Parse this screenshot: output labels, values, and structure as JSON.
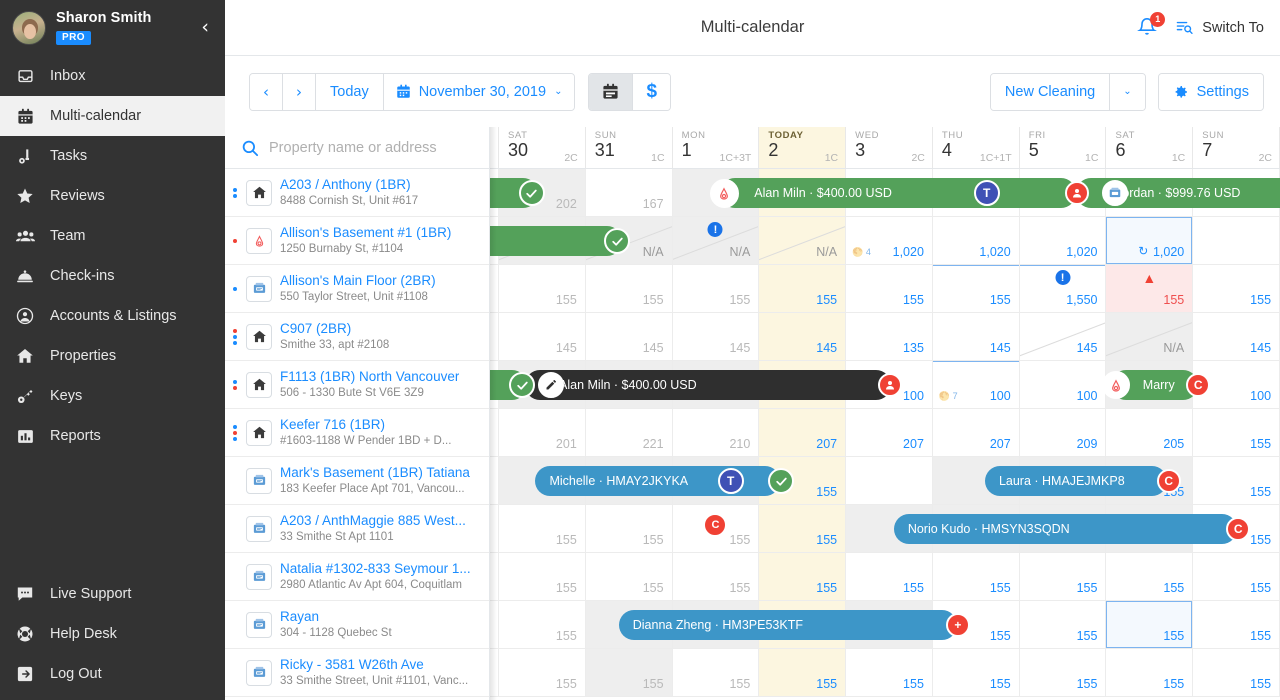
{
  "sidebar": {
    "user": {
      "name": "Sharon Smith",
      "badge": "PRO"
    },
    "collapse_label": "‹",
    "items": [
      {
        "label": "Inbox",
        "icon": "inbox-icon"
      },
      {
        "label": "Multi-calendar",
        "icon": "calendar-icon"
      },
      {
        "label": "Tasks",
        "icon": "tasks-icon"
      },
      {
        "label": "Reviews",
        "icon": "star-icon"
      },
      {
        "label": "Team",
        "icon": "team-icon"
      },
      {
        "label": "Check-ins",
        "icon": "bell-desk-icon"
      },
      {
        "label": "Accounts & Listings",
        "icon": "account-circle-icon"
      },
      {
        "label": "Properties",
        "icon": "home-icon"
      },
      {
        "label": "Keys",
        "icon": "key-icon"
      },
      {
        "label": "Reports",
        "icon": "bar-chart-icon"
      }
    ],
    "bottom_items": [
      {
        "label": "Live Support",
        "icon": "chat-icon"
      },
      {
        "label": "Help Desk",
        "icon": "lifebuoy-icon"
      },
      {
        "label": "Log Out",
        "icon": "logout-icon"
      }
    ]
  },
  "header": {
    "title": "Multi-calendar",
    "notification_count": "1",
    "switch_to": "Switch To"
  },
  "toolbar": {
    "prev": "‹",
    "next": "›",
    "today": "Today",
    "date_label": "November 30, 2019",
    "date_caret": "⌄",
    "view_calendar_icon": "calendar-view-icon",
    "view_money_icon": "dollar-icon",
    "money_symbol": "$",
    "new_cleaning": "New Cleaning",
    "new_cleaning_caret": "⌄",
    "settings": "Settings"
  },
  "search": {
    "placeholder": "Property name or address"
  },
  "days": [
    {
      "dow": "SAT",
      "num": "30",
      "cap": "2C",
      "today": false
    },
    {
      "dow": "SUN",
      "num": "31",
      "cap": "1C",
      "today": false
    },
    {
      "dow": "MON",
      "num": "1",
      "cap": "1C+3T",
      "today": false
    },
    {
      "dow": "TODAY",
      "num": "2",
      "cap": "1C",
      "today": true
    },
    {
      "dow": "WED",
      "num": "3",
      "cap": "2C",
      "today": false
    },
    {
      "dow": "THU",
      "num": "4",
      "cap": "1C+1T",
      "today": false
    },
    {
      "dow": "FRI",
      "num": "5",
      "cap": "1C",
      "today": false
    },
    {
      "dow": "SAT",
      "num": "6",
      "cap": "1C",
      "today": false
    },
    {
      "dow": "SUN",
      "num": "7",
      "cap": "2C",
      "today": false
    }
  ],
  "properties": [
    {
      "name": "A203 / Anthony (1BR)",
      "address": "8488 Cornish St, Unit #617",
      "icon": "home-icon",
      "dots": [
        "blue",
        "blue"
      ]
    },
    {
      "name": "Allison's Basement #1 (1BR)",
      "address": "1250 Burnaby St, #1104",
      "icon": "airbnb-icon",
      "dots": [
        "red"
      ]
    },
    {
      "name": "Allison's Main Floor (2BR)",
      "address": "550 Taylor Street, Unit #1108",
      "icon": "listing-icon",
      "dots": [
        "blue"
      ]
    },
    {
      "name": "C907 (2BR)",
      "address": "Smithe 33, apt #2108",
      "icon": "home-icon",
      "dots": [
        "red",
        "blue",
        "blue"
      ]
    },
    {
      "name": "F1113 (1BR) North Vancouver",
      "address": "506 - 1330 Bute St V6E 3Z9",
      "icon": "home-icon",
      "dots": [
        "blue",
        "red"
      ]
    },
    {
      "name": "Keefer 716 (1BR)",
      "address": "#1603-1188 W Pender 1BD + D...",
      "icon": "home-icon",
      "dots": [
        "blue",
        "red",
        "blue"
      ]
    },
    {
      "name": "Mark's Basement (1BR) Tatiana",
      "address": "183 Keefer Place Apt 701, Vancou...",
      "icon": "listing-icon",
      "dots": []
    },
    {
      "name": "A203 / AnthMaggie 885 West...",
      "address": "33 Smithe St Apt 1101",
      "icon": "listing-icon",
      "dots": []
    },
    {
      "name": "Natalia #1302-833 Seymour 1...",
      "address": "2980 Atlantic Av Apt 604, Coquitlam",
      "icon": "listing-icon",
      "dots": []
    },
    {
      "name": "Rayan",
      "address": "304 - 1128 Quebec St",
      "icon": "listing-icon",
      "dots": []
    },
    {
      "name": "Ricky - 3581 W26th Ave",
      "address": "33 Smithe Street, Unit #1101, Vanc...",
      "icon": "listing-icon",
      "dots": []
    }
  ],
  "rows": [
    {
      "prices": [
        "",
        "202",
        "167",
        "",
        "",
        "",
        "",
        "",
        "",
        ""
      ]
    },
    {
      "prices": [
        "",
        "N/A",
        "N/A",
        "N/A",
        "N/A",
        "1,020",
        "1,020",
        "1,020",
        "1,020",
        ""
      ]
    },
    {
      "prices": [
        "",
        "155",
        "155",
        "155",
        "155",
        "155",
        "155",
        "1,550",
        "155",
        "155"
      ]
    },
    {
      "prices": [
        "",
        "145",
        "145",
        "145",
        "145",
        "135",
        "145",
        "145",
        "N/A",
        "145"
      ]
    },
    {
      "prices": [
        "",
        "",
        "",
        "",
        "",
        "100",
        "100",
        "100",
        "",
        "100"
      ]
    },
    {
      "prices": [
        "",
        "201",
        "221",
        "210",
        "207",
        "207",
        "207",
        "209",
        "205",
        "155"
      ]
    },
    {
      "prices": [
        "",
        "",
        "",
        "",
        "155",
        "",
        "",
        "",
        "155",
        "155"
      ]
    },
    {
      "prices": [
        "",
        "155",
        "155",
        "155",
        "155",
        "",
        "",
        "",
        "",
        "155"
      ]
    },
    {
      "prices": [
        "",
        "155",
        "155",
        "155",
        "155",
        "155",
        "155",
        "155",
        "155",
        "155"
      ]
    },
    {
      "prices": [
        "",
        "155",
        "",
        "",
        "",
        "",
        "155",
        "155",
        "155",
        "155"
      ]
    },
    {
      "prices": [
        "",
        "155",
        "155",
        "155",
        "155",
        "155",
        "155",
        "155",
        "155",
        "155"
      ]
    }
  ],
  "bookings": [
    {
      "row": 0,
      "label": "Alan Miln · $400.00 USD",
      "color": "green",
      "badge_left": "airbnb-icon",
      "badge_right_t": "T",
      "badge_right": ""
    },
    {
      "row": 0,
      "label": "Jordan  · $999.76 USD",
      "color": "green",
      "badge_left": "guest-icon"
    },
    {
      "row": 4,
      "label": "Alan Miln · $400.00 USD",
      "color": "dark"
    },
    {
      "row": 4,
      "label": "Marry",
      "color": "green",
      "badge_right": "C"
    },
    {
      "row": 6,
      "label": "Michelle · HMAY2JKYKA",
      "color": "blue",
      "badge_right_t": "T"
    },
    {
      "row": 6,
      "label": "Laura · HMAJEJMKP8",
      "color": "blue",
      "badge_right": "C"
    },
    {
      "row": 7,
      "label": "Norio Kudo · HMSYN3SQDN",
      "color": "blue",
      "badge_right": "C"
    },
    {
      "row": 9,
      "label": "Dianna Zheng · HM3PE53KTF",
      "color": "blue",
      "badge_right": "+"
    }
  ],
  "colors": {
    "accent": "#1a8cff",
    "sidebar_bg": "#333333",
    "green": "#54a15a",
    "blue": "#3d96c8",
    "dark": "#2f2f2f",
    "red": "#f04134",
    "today_bg": "#fcf6e0"
  }
}
